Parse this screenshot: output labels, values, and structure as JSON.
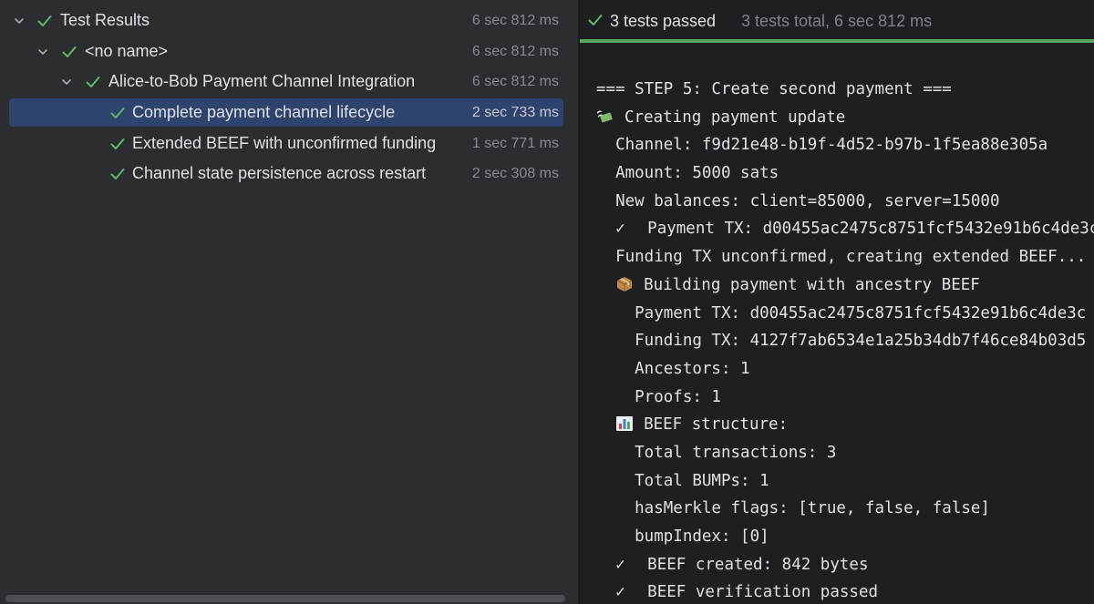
{
  "tree": {
    "rows": [
      {
        "label": "Test Results",
        "time": "6 sec 812 ms"
      },
      {
        "label": "<no name>",
        "time": "6 sec 812 ms"
      },
      {
        "label": "Alice-to-Bob Payment Channel Integration",
        "time": "6 sec 812 ms"
      },
      {
        "label": "Complete payment channel lifecycle",
        "time": "2 sec 733 ms"
      },
      {
        "label": "Extended BEEF with unconfirmed funding",
        "time": "1 sec 771 ms"
      },
      {
        "label": "Channel state persistence across restart",
        "time": "2 sec 308 ms"
      }
    ]
  },
  "summary": {
    "passed": "3 tests passed",
    "total": "3 tests total, 6 sec 812 ms"
  },
  "console": {
    "lines": [
      "=== STEP 5: Create second payment ===",
      "Creating payment update",
      "  Channel: f9d21e48-b19f-4d52-b97b-1f5ea88e305a",
      "  Amount: 5000 sats",
      "  New balances: client=85000, server=15000",
      "Payment TX: d00455ac2475c8751fcf5432e91b6c4de3c",
      "  Funding TX unconfirmed, creating extended BEEF...",
      "Building payment with ancestry BEEF",
      "    Payment TX: d00455ac2475c8751fcf5432e91b6c4de3c",
      "    Funding TX: 4127f7ab6534e1a25b34db7f46ce84b03d5",
      "    Ancestors: 1",
      "    Proofs: 1",
      "BEEF structure:",
      "    Total transactions: 3",
      "    Total BUMPs: 1",
      "    hasMerkle flags: [true, false, false]",
      "    bumpIndex: [0]",
      "BEEF created: 842 bytes",
      "BEEF verification passed"
    ]
  },
  "colors": {
    "pass_green": "#5fb865",
    "selection": "#2e436e",
    "progress": "#56a85c"
  }
}
